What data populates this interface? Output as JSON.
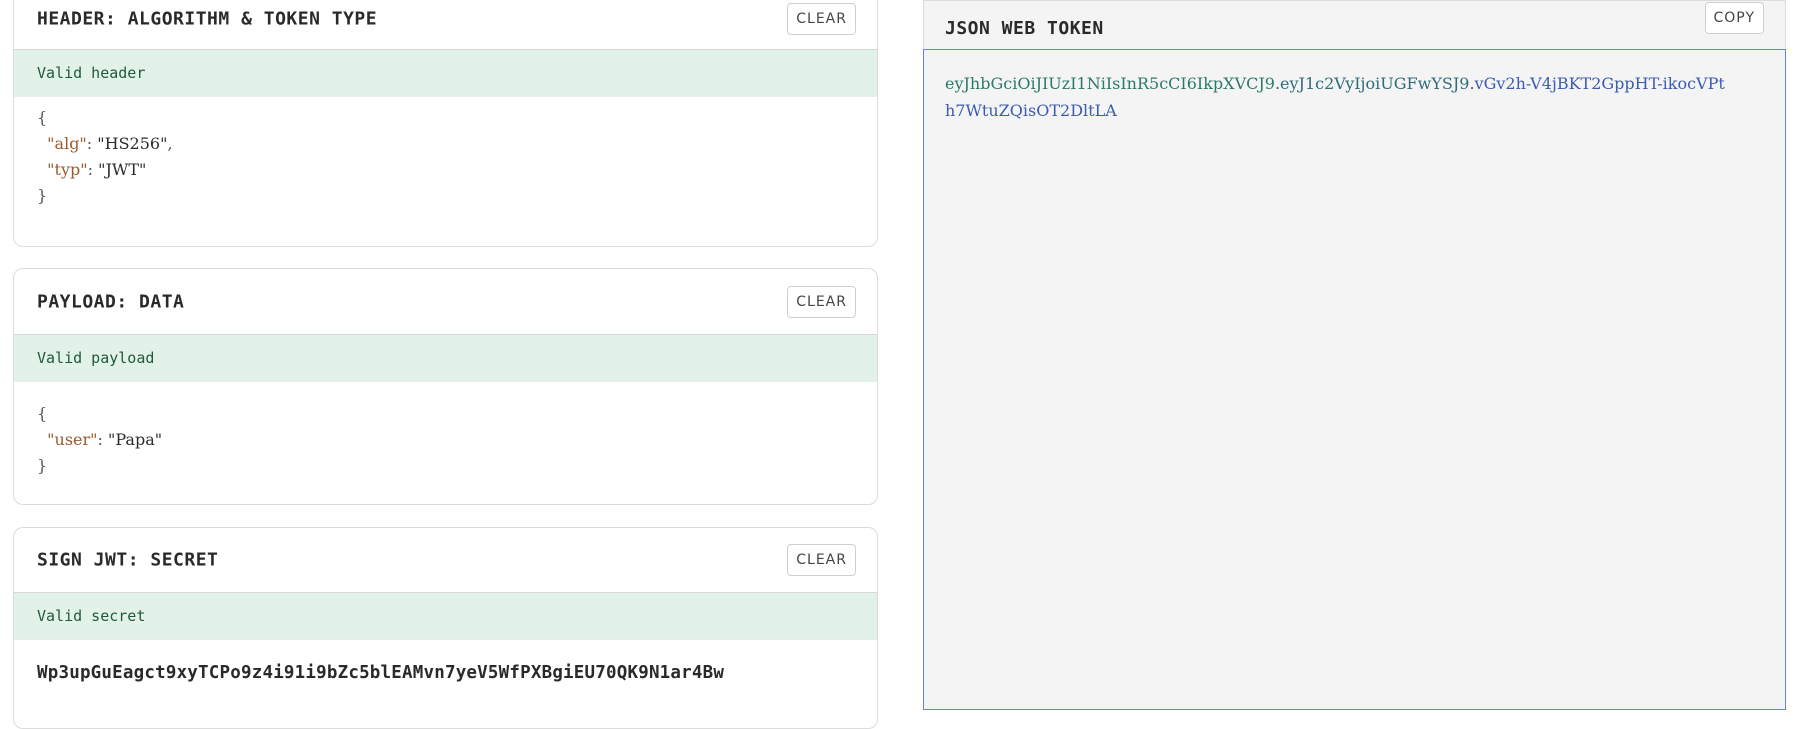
{
  "header_card": {
    "title": "HEADER: ALGORITHM & TOKEN TYPE",
    "clear_label": "CLEAR",
    "status": "Valid header",
    "json": {
      "open": "{",
      "alg_key": "\"alg\"",
      "alg_value": "\"HS256\"",
      "typ_key": "\"typ\"",
      "typ_value": "\"JWT\"",
      "close": "}"
    }
  },
  "payload_card": {
    "title": "PAYLOAD: DATA",
    "clear_label": "CLEAR",
    "status": "Valid payload",
    "json": {
      "open": "{",
      "user_key": "\"user\"",
      "user_value": "\"Papa\"",
      "close": "}"
    }
  },
  "secret_card": {
    "title": "SIGN JWT: SECRET",
    "clear_label": "CLEAR",
    "status": "Valid secret",
    "secret": "Wp3upGuEagct9xyTCPo9z4i91i9bZc5blEAMvn7yeV5WfPXBgiEU70QK9N1ar4Bw"
  },
  "token_panel": {
    "title": "JSON WEB TOKEN",
    "copy_label": "COPY",
    "token_header": "eyJhbGciOiJIUzI1NiIsInR5cCI6IkpXVCJ9",
    "token_payload": "eyJ1c2VyIjoiUGFwYSJ9",
    "token_signature": "vGv2h-V4jBKT2GppHT-ikocVPth7WtuZQisOT2DltLA",
    "dot": "."
  },
  "colors": {
    "valid_bg": "#e3f2e8",
    "valid_text": "#1f5a3a",
    "token_border": "#6b84d8"
  }
}
